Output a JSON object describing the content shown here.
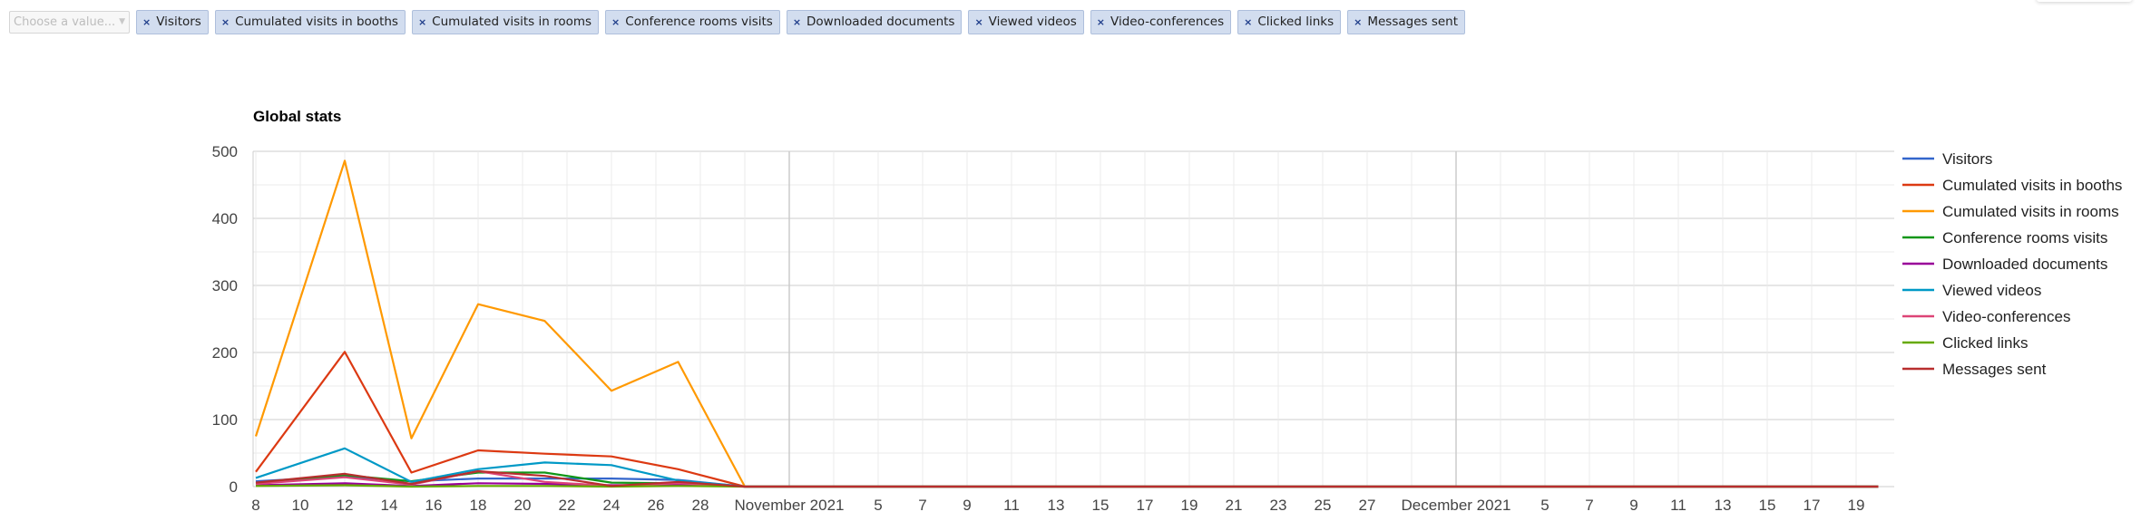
{
  "filter": {
    "placeholder": "Choose a value...",
    "caret_icon": "caret-down",
    "remove_icon": "×",
    "selected_tags": [
      "Visitors",
      "Cumulated visits in booths",
      "Cumulated visits in rooms",
      "Conference rooms visits",
      "Downloaded documents",
      "Viewed videos",
      "Video-conferences",
      "Clicked links",
      "Messages sent"
    ]
  },
  "chart_data": {
    "type": "line",
    "title": "Global stats",
    "xlabel": "",
    "ylabel": "",
    "ylim": [
      0,
      500
    ],
    "yticks": [
      0,
      100,
      200,
      300,
      400,
      500
    ],
    "grid": true,
    "legend_position": "right",
    "x_axis": {
      "start": "2021-10-08",
      "end": "2021-12-20",
      "tick_labels": [
        {
          "date": "2021-10-08",
          "label": "8"
        },
        {
          "date": "2021-10-10",
          "label": "10"
        },
        {
          "date": "2021-10-12",
          "label": "12"
        },
        {
          "date": "2021-10-14",
          "label": "14"
        },
        {
          "date": "2021-10-16",
          "label": "16"
        },
        {
          "date": "2021-10-18",
          "label": "18"
        },
        {
          "date": "2021-10-20",
          "label": "20"
        },
        {
          "date": "2021-10-22",
          "label": "22"
        },
        {
          "date": "2021-10-24",
          "label": "24"
        },
        {
          "date": "2021-10-26",
          "label": "26"
        },
        {
          "date": "2021-10-28",
          "label": "28"
        },
        {
          "date": "2021-11-01",
          "label": "November 2021",
          "major": true
        },
        {
          "date": "2021-11-05",
          "label": "5"
        },
        {
          "date": "2021-11-07",
          "label": "7"
        },
        {
          "date": "2021-11-09",
          "label": "9"
        },
        {
          "date": "2021-11-11",
          "label": "11"
        },
        {
          "date": "2021-11-13",
          "label": "13"
        },
        {
          "date": "2021-11-15",
          "label": "15"
        },
        {
          "date": "2021-11-17",
          "label": "17"
        },
        {
          "date": "2021-11-19",
          "label": "19"
        },
        {
          "date": "2021-11-21",
          "label": "21"
        },
        {
          "date": "2021-11-23",
          "label": "23"
        },
        {
          "date": "2021-11-25",
          "label": "25"
        },
        {
          "date": "2021-11-27",
          "label": "27"
        },
        {
          "date": "2021-12-01",
          "label": "December 2021",
          "major": true
        },
        {
          "date": "2021-12-05",
          "label": "5"
        },
        {
          "date": "2021-12-07",
          "label": "7"
        },
        {
          "date": "2021-12-09",
          "label": "9"
        },
        {
          "date": "2021-12-11",
          "label": "11"
        },
        {
          "date": "2021-12-13",
          "label": "13"
        },
        {
          "date": "2021-12-15",
          "label": "15"
        },
        {
          "date": "2021-12-17",
          "label": "17"
        },
        {
          "date": "2021-12-19",
          "label": "19"
        }
      ]
    },
    "x": [
      "2021-10-08",
      "2021-10-12",
      "2021-10-15",
      "2021-10-18",
      "2021-10-21",
      "2021-10-24",
      "2021-10-27",
      "2021-10-30",
      "2021-12-20"
    ],
    "series": [
      {
        "name": "Visitors",
        "color": "#3366cc",
        "values": [
          8,
          15,
          8,
          12,
          12,
          12,
          10,
          0,
          0
        ]
      },
      {
        "name": "Cumulated visits in booths",
        "color": "#dc3912",
        "values": [
          22,
          201,
          21,
          54,
          49,
          45,
          26,
          0,
          0
        ]
      },
      {
        "name": "Cumulated visits in rooms",
        "color": "#ff9900",
        "values": [
          75,
          486,
          72,
          272,
          247,
          143,
          186,
          0,
          0
        ]
      },
      {
        "name": "Conference rooms visits",
        "color": "#109618",
        "values": [
          5,
          17,
          8,
          21,
          21,
          6,
          5,
          0,
          0
        ]
      },
      {
        "name": "Downloaded documents",
        "color": "#990099",
        "values": [
          2,
          5,
          1,
          5,
          4,
          2,
          3,
          0,
          0
        ]
      },
      {
        "name": "Viewed videos",
        "color": "#0099c6",
        "values": [
          13,
          57,
          7,
          26,
          36,
          32,
          9,
          0,
          0
        ]
      },
      {
        "name": "Video-conferences",
        "color": "#dd4477",
        "values": [
          4,
          14,
          3,
          23,
          7,
          1,
          5,
          0,
          0
        ]
      },
      {
        "name": "Clicked links",
        "color": "#66aa00",
        "values": [
          1,
          2,
          0,
          1,
          1,
          0,
          1,
          0,
          0
        ]
      },
      {
        "name": "Messages sent",
        "color": "#b82e2e",
        "values": [
          6,
          19,
          4,
          23,
          16,
          1,
          7,
          0,
          0
        ]
      }
    ]
  }
}
